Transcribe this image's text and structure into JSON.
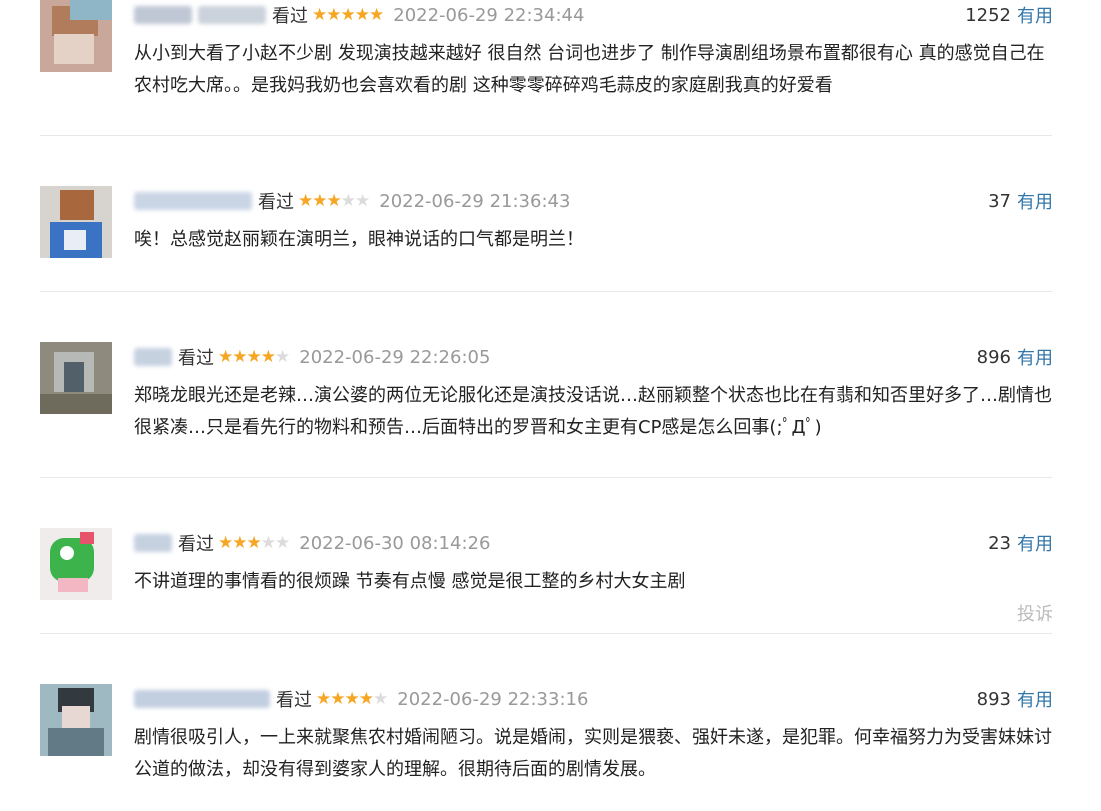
{
  "comments": [
    {
      "watched": "看过",
      "rating": 5,
      "time": "2022-06-29 22:34:44",
      "votes": "1252",
      "useful": "有用",
      "text": "从小到大看了小赵不少剧 发现演技越来越好 很自然 台词也进步了 制作导演剧组场景布置都很有心 真的感觉自己在农村吃大席。。是我妈我奶也会喜欢看的剧 这种零零碎碎鸡毛蒜皮的家庭剧我真的好爱看"
    },
    {
      "watched": "看过",
      "rating": 3,
      "time": "2022-06-29 21:36:43",
      "votes": "37",
      "useful": "有用",
      "text": "唉！总感觉赵丽颖在演明兰，眼神说话的口气都是明兰！"
    },
    {
      "watched": "看过",
      "rating": 4,
      "time": "2022-06-29 22:26:05",
      "votes": "896",
      "useful": "有用",
      "text": "郑晓龙眼光还是老辣…演公婆的两位无论服化还是演技没话说…赵丽颖整个状态也比在有翡和知否里好多了…剧情也很紧凑…只是看先行的物料和预告…后面特出的罗晋和女主更有CP感是怎么回事(;ﾟДﾟ)"
    },
    {
      "watched": "看过",
      "rating": 3,
      "time": "2022-06-30 08:14:26",
      "votes": "23",
      "useful": "有用",
      "text": "不讲道理的事情看的很烦躁 节奏有点慢 感觉是很工整的乡村大女主剧",
      "report": "投诉"
    },
    {
      "watched": "看过",
      "rating": 4,
      "time": "2022-06-29 22:33:16",
      "votes": "893",
      "useful": "有用",
      "text": "剧情很吸引人，一上来就聚焦农村婚闹陋习。说是婚闹，实则是猥亵、强奸未遂，是犯罪。何幸福努力为受害妹妹讨公道的做法，却没有得到婆家人的理解。很期待后面的剧情发展。"
    }
  ],
  "colors": {
    "star_on": "#f6a623",
    "star_off": "#dcdcdc",
    "link": "#3377aa",
    "meta": "#999999",
    "divider": "#e8e8e8"
  },
  "icons": {
    "star": "star-icon",
    "avatar": "user-avatar"
  }
}
